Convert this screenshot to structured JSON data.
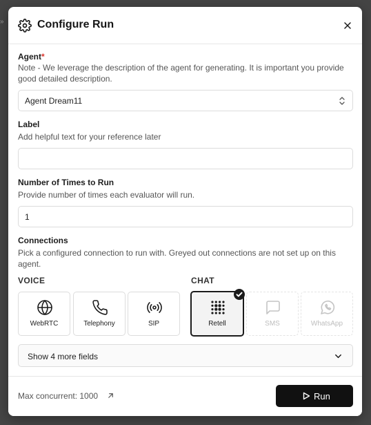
{
  "modal": {
    "title": "Configure Run",
    "agent": {
      "label": "Agent",
      "required_mark": "*",
      "help": "Note - We leverage the description of the agent for generating. It is important you provide good detailed description.",
      "selected": "Agent Dream11"
    },
    "label_field": {
      "label": "Label",
      "help": "Add helpful text for your reference later",
      "value": "",
      "placeholder": ""
    },
    "times": {
      "label": "Number of Times to Run",
      "help": "Provide number of times each evaluator will run.",
      "value": "1"
    },
    "connections": {
      "label": "Connections",
      "help": "Pick a configured connection to run with. Greyed out connections are not set up on this agent.",
      "voice_caption": "VOICE",
      "chat_caption": "CHAT",
      "voice": [
        {
          "label": "WebRTC",
          "icon": "globe-icon",
          "state": "enabled"
        },
        {
          "label": "Telephony",
          "icon": "phone-icon",
          "state": "enabled"
        },
        {
          "label": "SIP",
          "icon": "broadcast-icon",
          "state": "enabled"
        }
      ],
      "chat": [
        {
          "label": "Retell",
          "icon": "retell-dots-icon",
          "state": "selected"
        },
        {
          "label": "SMS",
          "icon": "message-icon",
          "state": "disabled"
        },
        {
          "label": "WhatsApp",
          "icon": "whatsapp-icon",
          "state": "disabled"
        }
      ]
    },
    "more_fields": "Show 4 more fields",
    "footer": {
      "max_concurrent": "Max concurrent: 1000",
      "run_label": "Run"
    }
  },
  "colors": {
    "primary": "#111111",
    "required": "#d9342b",
    "border": "#dcdcdc",
    "disabled_text": "#bdbdbd"
  }
}
